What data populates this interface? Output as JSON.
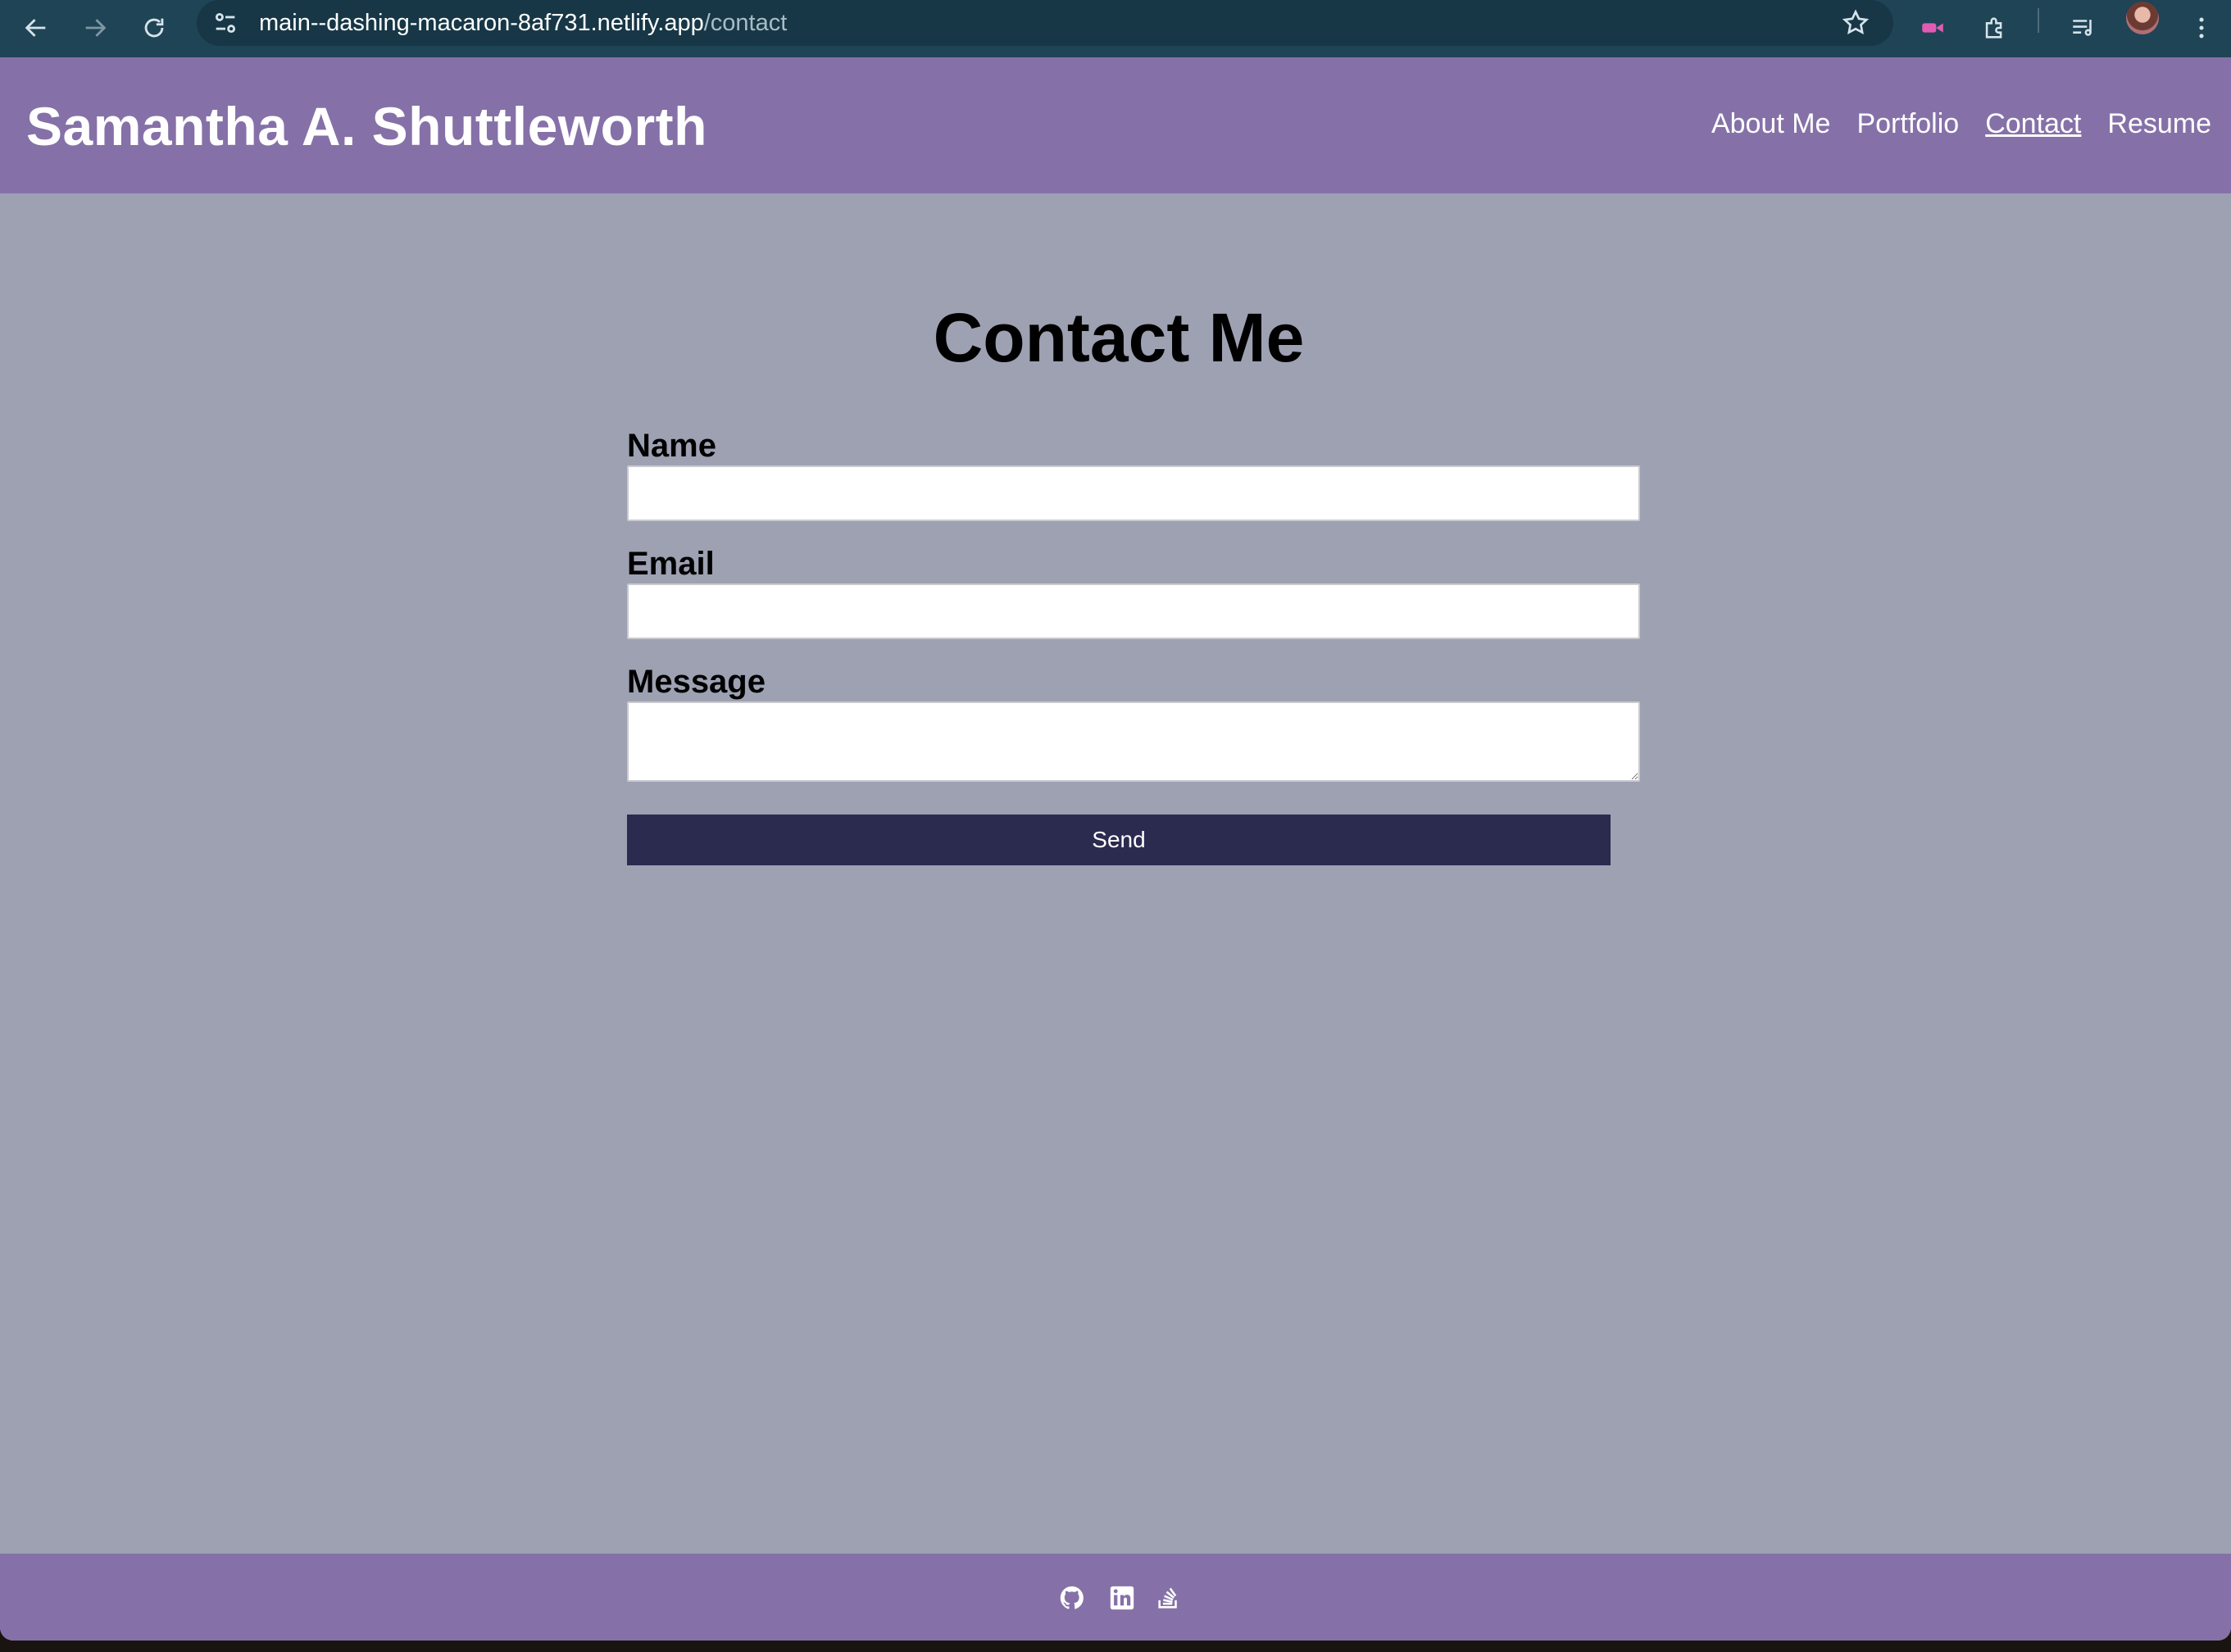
{
  "browser": {
    "url_host": "main--dashing-macaron-8af731.netlify.app",
    "url_path": "/contact",
    "icons": [
      "back-arrow-icon",
      "forward-arrow-icon",
      "reload-icon",
      "site-settings-icon",
      "bookmark-star-icon",
      "extension-puzzle-icon",
      "media-queue-icon",
      "profile-avatar",
      "more-menu-icon"
    ]
  },
  "header": {
    "title": "Samantha A. Shuttleworth",
    "nav": [
      {
        "label": "About Me"
      },
      {
        "label": "Portfolio"
      },
      {
        "label": "Contact",
        "active": true
      },
      {
        "label": "Resume"
      }
    ]
  },
  "contact": {
    "heading": "Contact Me",
    "name_label": "Name",
    "name_value": "",
    "email_label": "Email",
    "email_value": "",
    "message_label": "Message",
    "message_value": "",
    "send_label": "Send"
  },
  "footer": {
    "icons": [
      "github-icon",
      "linkedin-icon",
      "stackoverflow-icon"
    ]
  },
  "colors": {
    "chrome": "#1f4456",
    "header": "#8571a8",
    "page_bg": "#9da1b2",
    "button": "#2b2a4f"
  }
}
